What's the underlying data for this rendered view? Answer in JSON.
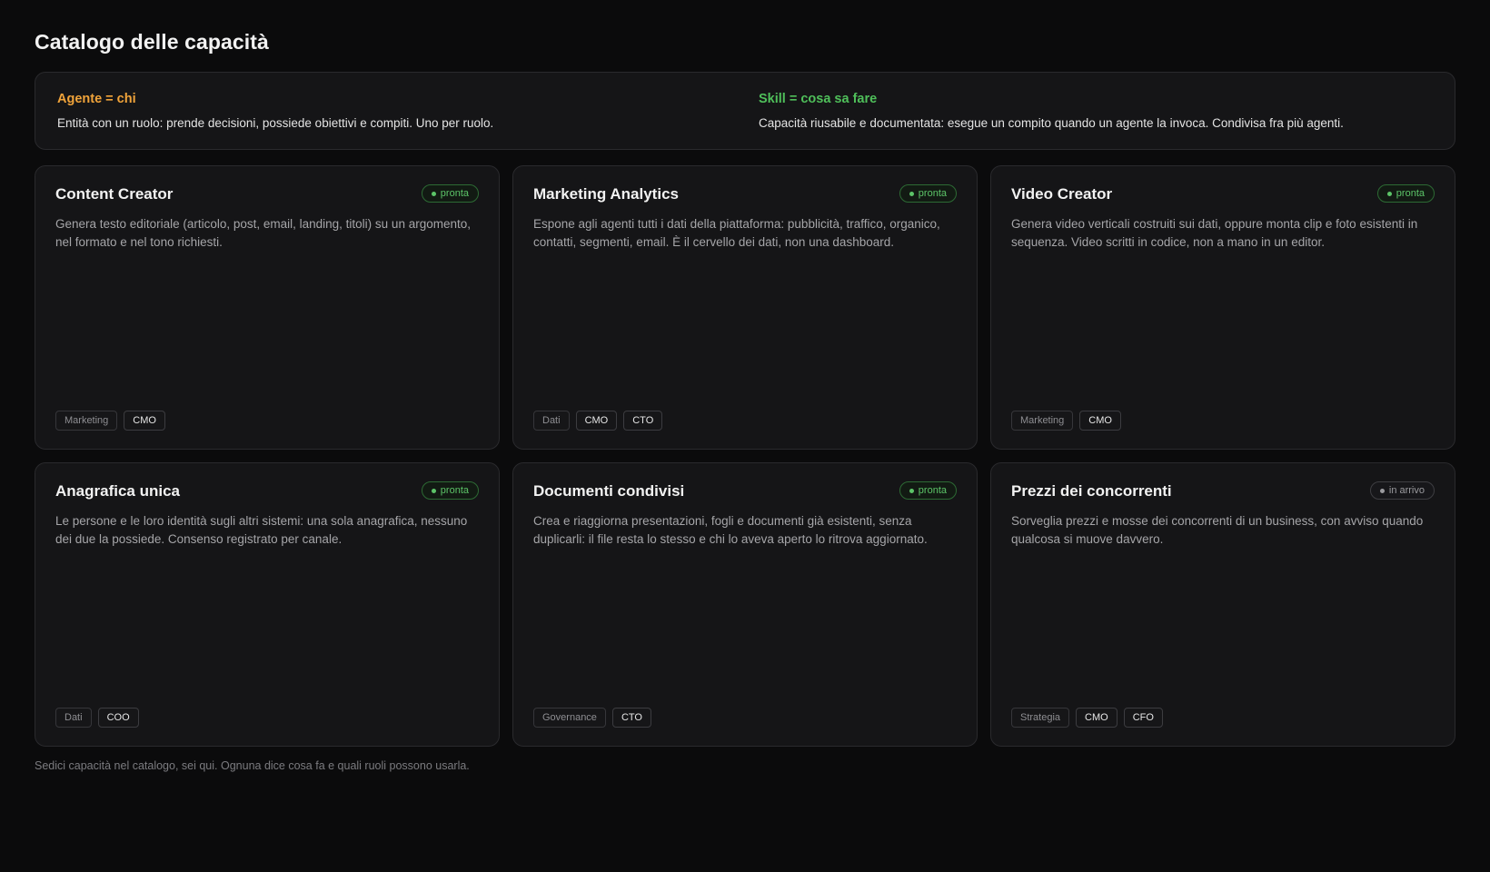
{
  "page": {
    "title": "Catalogo delle capacità",
    "footer": "Sedici capacità nel catalogo, sei qui. Ognuna dice cosa fa e quali ruoli possono usarla."
  },
  "intro": {
    "agent": {
      "heading": "Agente = chi",
      "text": "Entità con un ruolo: prende decisioni, possiede obiettivi e compiti. Uno per ruolo."
    },
    "skill": {
      "heading": "Skill = cosa sa fare",
      "text": "Capacità riusabile e documentata: esegue un compito quando un agente la invoca. Condivisa fra più agenti."
    }
  },
  "colors": {
    "agent_accent": "#f0a33a",
    "skill_accent": "#4fbf5a",
    "ready_badge": "#5cc468",
    "soon_badge": "#9a9a9e"
  },
  "cards": [
    {
      "title": "Content Creator",
      "status": "pronta",
      "status_kind": "ready",
      "description": "Genera testo editoriale (articolo, post, email, landing, titoli) su un argomento, nel formato e nel tono richiesti.",
      "area": "Marketing",
      "roles": [
        "CMO"
      ]
    },
    {
      "title": "Marketing Analytics",
      "status": "pronta",
      "status_kind": "ready",
      "description": "Espone agli agenti tutti i dati della piattaforma: pubblicità, traffico, organico, contatti, segmenti, email. È il cervello dei dati, non una dashboard.",
      "area": "Dati",
      "roles": [
        "CMO",
        "CTO"
      ]
    },
    {
      "title": "Video Creator",
      "status": "pronta",
      "status_kind": "ready",
      "description": "Genera video verticali costruiti sui dati, oppure monta clip e foto esistenti in sequenza. Video scritti in codice, non a mano in un editor.",
      "area": "Marketing",
      "roles": [
        "CMO"
      ]
    },
    {
      "title": "Anagrafica unica",
      "status": "pronta",
      "status_kind": "ready",
      "description": "Le persone e le loro identità sugli altri sistemi: una sola anagrafica, nessuno dei due la possiede. Consenso registrato per canale.",
      "area": "Dati",
      "roles": [
        "COO"
      ]
    },
    {
      "title": "Documenti condivisi",
      "status": "pronta",
      "status_kind": "ready",
      "description": "Crea e riaggiorna presentazioni, fogli e documenti già esistenti, senza duplicarli: il file resta lo stesso e chi lo aveva aperto lo ritrova aggiornato.",
      "area": "Governance",
      "roles": [
        "CTO"
      ]
    },
    {
      "title": "Prezzi dei concorrenti",
      "status": "in arrivo",
      "status_kind": "soon",
      "description": "Sorveglia prezzi e mosse dei concorrenti di un business, con avviso quando qualcosa si muove davvero.",
      "area": "Strategia",
      "roles": [
        "CMO",
        "CFO"
      ]
    }
  ]
}
